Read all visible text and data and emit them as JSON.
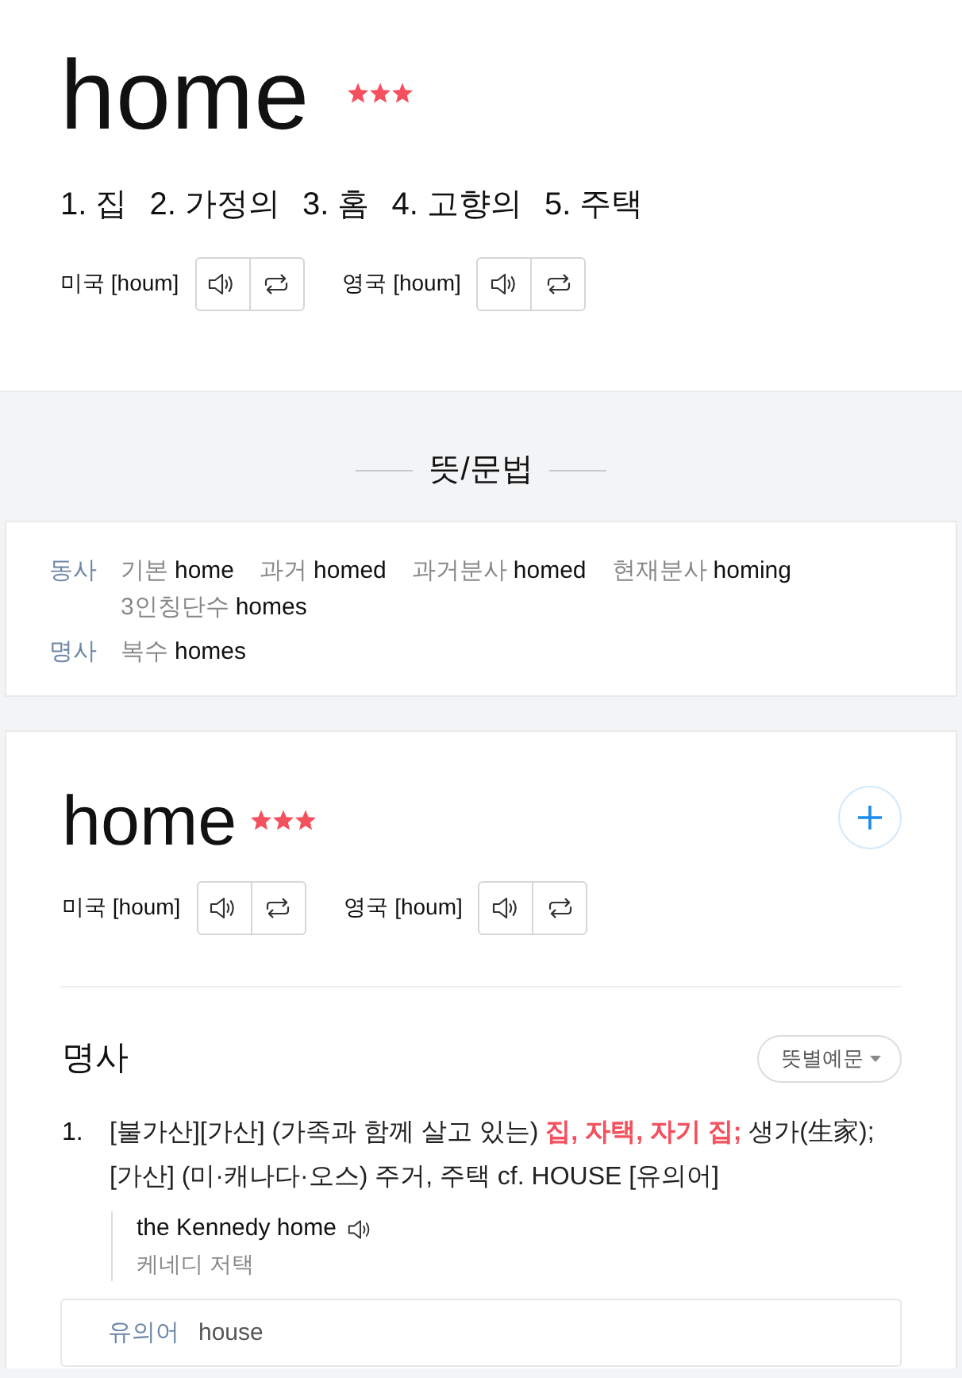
{
  "header": {
    "word": "home",
    "stars": 3,
    "meanings": [
      "1. 집",
      "2. 가정의",
      "3. 홈",
      "4. 고향의",
      "5. 주택"
    ],
    "pronunciations": [
      {
        "label": "미국 [houm]"
      },
      {
        "label": "영국 [houm]"
      }
    ]
  },
  "grammar": {
    "title": "뜻/문법",
    "rows": [
      {
        "pos": "동사",
        "forms": [
          {
            "label": "기본",
            "value": "home"
          },
          {
            "label": "과거",
            "value": "homed"
          },
          {
            "label": "과거분사",
            "value": "homed"
          },
          {
            "label": "현재분사",
            "value": "homing"
          },
          {
            "label": "3인칭단수",
            "value": "homes"
          }
        ]
      },
      {
        "pos": "명사",
        "forms": [
          {
            "label": "복수",
            "value": "homes"
          }
        ]
      }
    ]
  },
  "entry": {
    "word": "home",
    "stars": 3,
    "pronunciations": [
      {
        "label": "미국 [houm]"
      },
      {
        "label": "영국 [houm]"
      }
    ],
    "part_of_speech": "명사",
    "filter_button": "뜻별예문",
    "definitions": [
      {
        "number": "1.",
        "text": "[불가산][가산] (가족과 함께 살고 있는) **집, 자택, 자기 집;** 생가(生家); [가산] (미·캐나다·오스) 주거, 주택 cf. HOUSE [유의어]",
        "examples": [
          {
            "sentence": "the Kennedy home",
            "translation": "케네디 저택"
          }
        ]
      }
    ],
    "synonyms": {
      "label": "유의어",
      "words": [
        "house"
      ]
    }
  }
}
